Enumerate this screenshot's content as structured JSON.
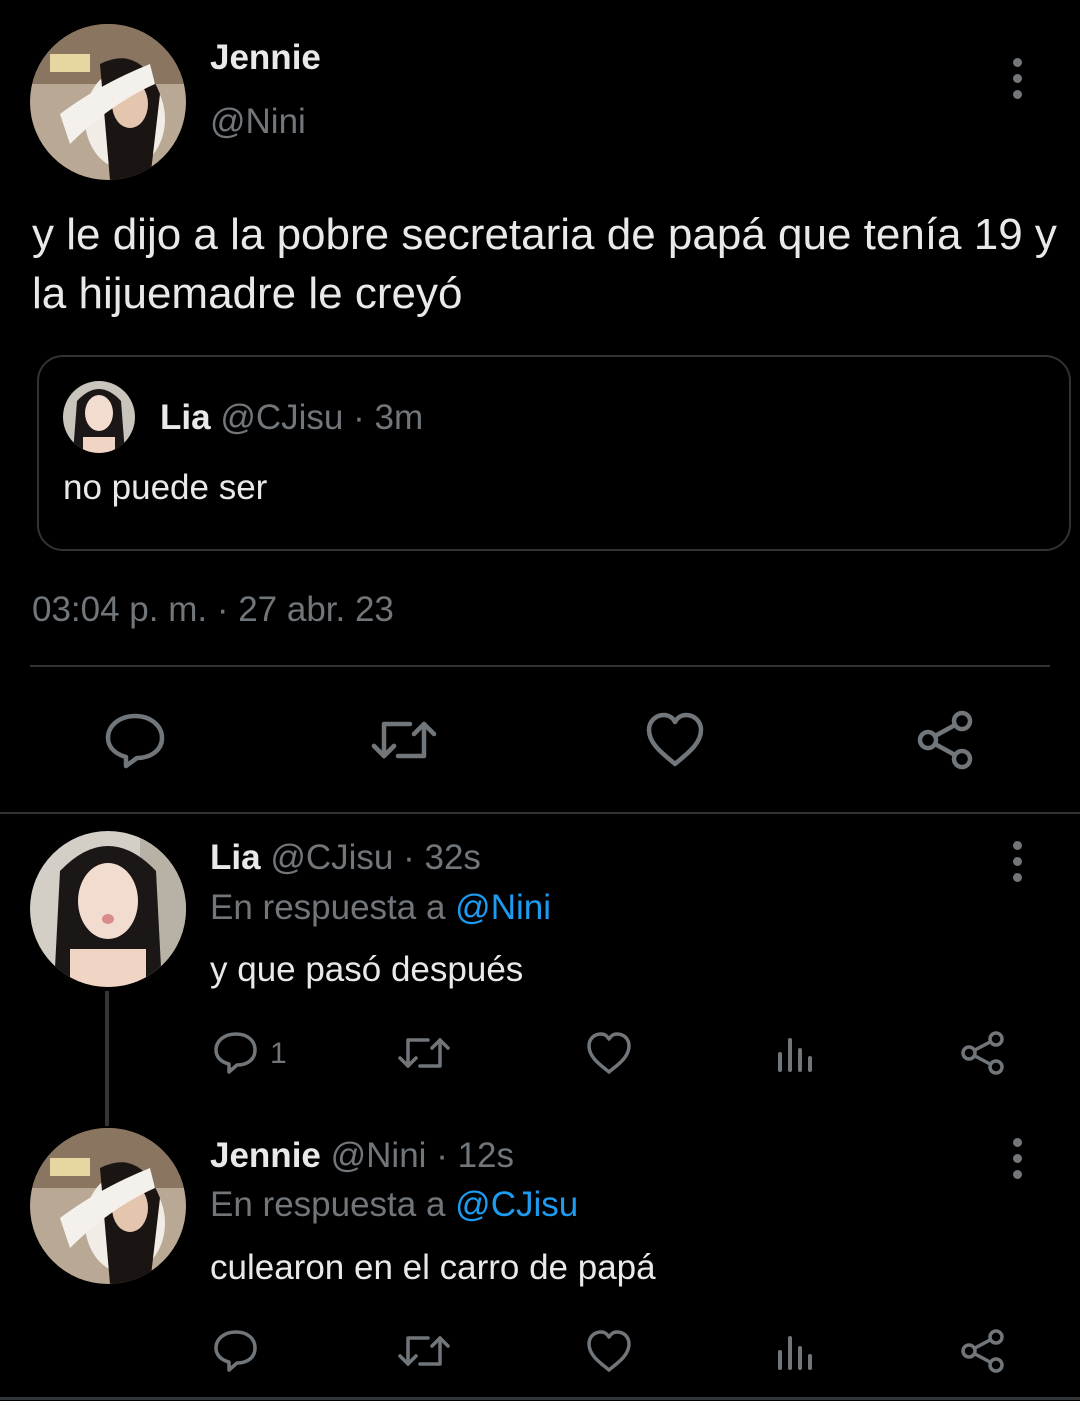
{
  "main_tweet": {
    "author_name": "Jennie",
    "author_handle": "@Nini",
    "text": "y le dijo a la pobre secretaria de papá que tenía 19 y la hijuemadre le creyó",
    "timestamp": "03:04 p. m. · 27 abr. 23",
    "quoted": {
      "name": "Lia",
      "handle": "@CJisu",
      "time": "· 3m",
      "text": "no puede ser"
    }
  },
  "replies": [
    {
      "name": "Lia",
      "handle": "@CJisu",
      "time": "· 32s",
      "in_reply_prefix": "En respuesta a",
      "in_reply_handle": "@Nini",
      "text": "y que pasó después",
      "reply_count": "1"
    },
    {
      "name": "Jennie",
      "handle": "@Nini",
      "time": "· 12s",
      "in_reply_prefix": "En respuesta a",
      "in_reply_handle": "@CJisu",
      "text": "culearon en el carro de papá",
      "reply_count": ""
    }
  ],
  "colors": {
    "background": "#000000",
    "text": "#e7e9ea",
    "secondary": "#71767b",
    "accent": "#1d9bf0",
    "border": "#2f3336"
  },
  "icons": [
    "reply-icon",
    "retweet-icon",
    "like-icon",
    "views-icon",
    "share-icon",
    "more-icon"
  ]
}
